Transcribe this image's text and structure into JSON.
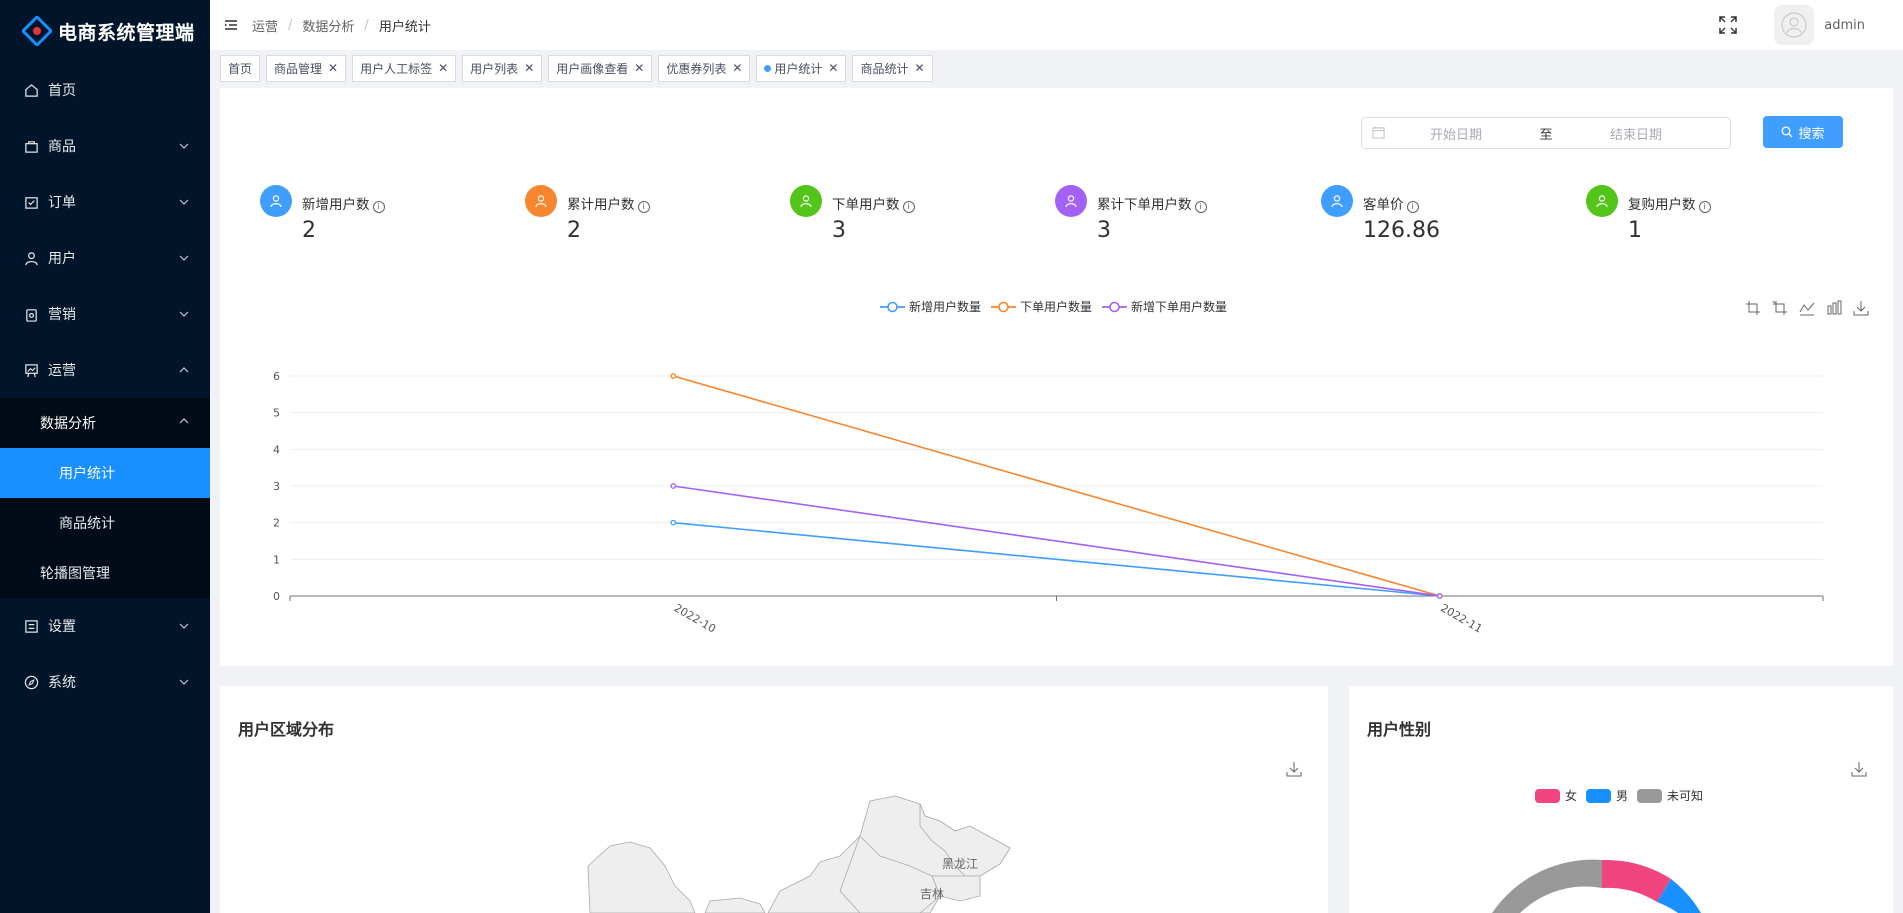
{
  "app": {
    "title": "电商系统管理端"
  },
  "sidebar": {
    "items": [
      {
        "label": "首页",
        "icon": "home-icon",
        "expandable": false
      },
      {
        "label": "商品",
        "icon": "bag-icon",
        "expandable": true
      },
      {
        "label": "订单",
        "icon": "order-icon",
        "expandable": true
      },
      {
        "label": "用户",
        "icon": "user-icon",
        "expandable": true
      },
      {
        "label": "营销",
        "icon": "marketing-icon",
        "expandable": true
      },
      {
        "label": "运营",
        "icon": "operation-icon",
        "expandable": true,
        "expanded": true
      }
    ],
    "operation_sub": {
      "data_analysis": "数据分析",
      "user_stats": "用户统计",
      "product_stats": "商品统计",
      "carousel": "轮播图管理"
    },
    "settings": "设置",
    "system": "系统"
  },
  "header": {
    "breadcrumb": [
      "运营",
      "数据分析",
      "用户统计"
    ],
    "username": "admin"
  },
  "tabs": [
    {
      "label": "首页",
      "closable": false
    },
    {
      "label": "商品管理",
      "closable": true
    },
    {
      "label": "用户人工标签",
      "closable": true
    },
    {
      "label": "用户列表",
      "closable": true
    },
    {
      "label": "用户画像查看",
      "closable": true
    },
    {
      "label": "优惠券列表",
      "closable": true
    },
    {
      "label": "用户统计",
      "closable": true,
      "active": true
    },
    {
      "label": "商品统计",
      "closable": true
    }
  ],
  "filter": {
    "start_placeholder": "开始日期",
    "separator": "至",
    "end_placeholder": "结束日期",
    "search_label": "搜索"
  },
  "stats": [
    {
      "label": "新增用户数",
      "value": "2",
      "color": "#409eff"
    },
    {
      "label": "累计用户数",
      "value": "2",
      "color": "#f7862f"
    },
    {
      "label": "下单用户数",
      "value": "3",
      "color": "#52c41a"
    },
    {
      "label": "累计下单用户数",
      "value": "3",
      "color": "#a361f5"
    },
    {
      "label": "客单价",
      "value": "126.86",
      "color": "#409eff"
    },
    {
      "label": "复购用户数",
      "value": "1",
      "color": "#52c41a"
    }
  ],
  "chart_data": {
    "type": "line",
    "categories": [
      "2022-10",
      "2022-11"
    ],
    "series": [
      {
        "name": "新增用户数量",
        "values": [
          2,
          0
        ],
        "color": "#409eff"
      },
      {
        "name": "下单用户数量",
        "values": [
          6,
          0
        ],
        "color": "#f7862f"
      },
      {
        "name": "新增下单用户数量",
        "values": [
          3,
          0
        ],
        "color": "#a361f5"
      }
    ],
    "yticks": [
      0,
      1,
      2,
      3,
      4,
      5,
      6
    ],
    "ylim": [
      0,
      6
    ],
    "grid": true,
    "legend_position": "top"
  },
  "region_card": {
    "title": "用户区域分布",
    "map_labels": [
      "黑龙江",
      "吉林"
    ]
  },
  "gender_card": {
    "title": "用户性别",
    "legend": [
      {
        "label": "女",
        "color": "#f0457f"
      },
      {
        "label": "男",
        "color": "#1890ff"
      },
      {
        "label": "未可知",
        "color": "#999999"
      }
    ]
  }
}
